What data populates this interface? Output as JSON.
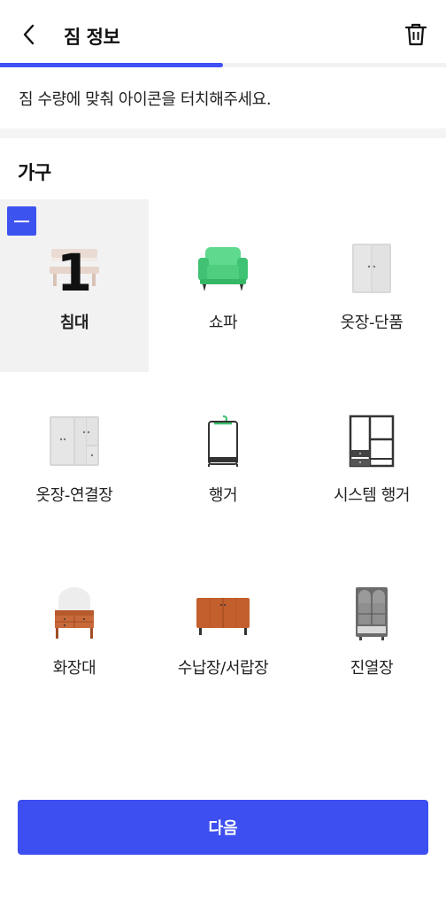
{
  "header": {
    "title": "짐 정보",
    "back_icon": "chevron-left-icon",
    "delete_icon": "trash-icon"
  },
  "progress": {
    "value_percent": 50,
    "color": "#3f51f5"
  },
  "instruction": "짐 수량에 맞춰 아이콘을 터치해주세요.",
  "section": {
    "title": "가구"
  },
  "items": [
    {
      "label": "침대",
      "icon": "bed-icon",
      "selected": true,
      "count": "1"
    },
    {
      "label": "쇼파",
      "icon": "sofa-icon",
      "selected": false
    },
    {
      "label": "옷장-단품",
      "icon": "wardrobe-single-icon",
      "selected": false
    },
    {
      "label": "옷장-연결장",
      "icon": "wardrobe-combined-icon",
      "selected": false
    },
    {
      "label": "행거",
      "icon": "hanger-icon",
      "selected": false
    },
    {
      "label": "시스템 행거",
      "icon": "system-hanger-icon",
      "selected": false
    },
    {
      "label": "화장대",
      "icon": "vanity-icon",
      "selected": false
    },
    {
      "label": "수납장/서랍장",
      "icon": "cabinet-icon",
      "selected": false
    },
    {
      "label": "진열장",
      "icon": "display-cabinet-icon",
      "selected": false
    },
    {
      "label": "",
      "icon": "table-icon",
      "selected": false
    },
    {
      "label": "",
      "icon": "tv-stand-icon",
      "selected": false
    },
    {
      "label": "",
      "icon": "bookshelf-icon",
      "selected": false
    }
  ],
  "footer": {
    "next_label": "다음"
  },
  "colors": {
    "accent": "#3d4ff0",
    "selected_bg": "#f2f2f2"
  }
}
